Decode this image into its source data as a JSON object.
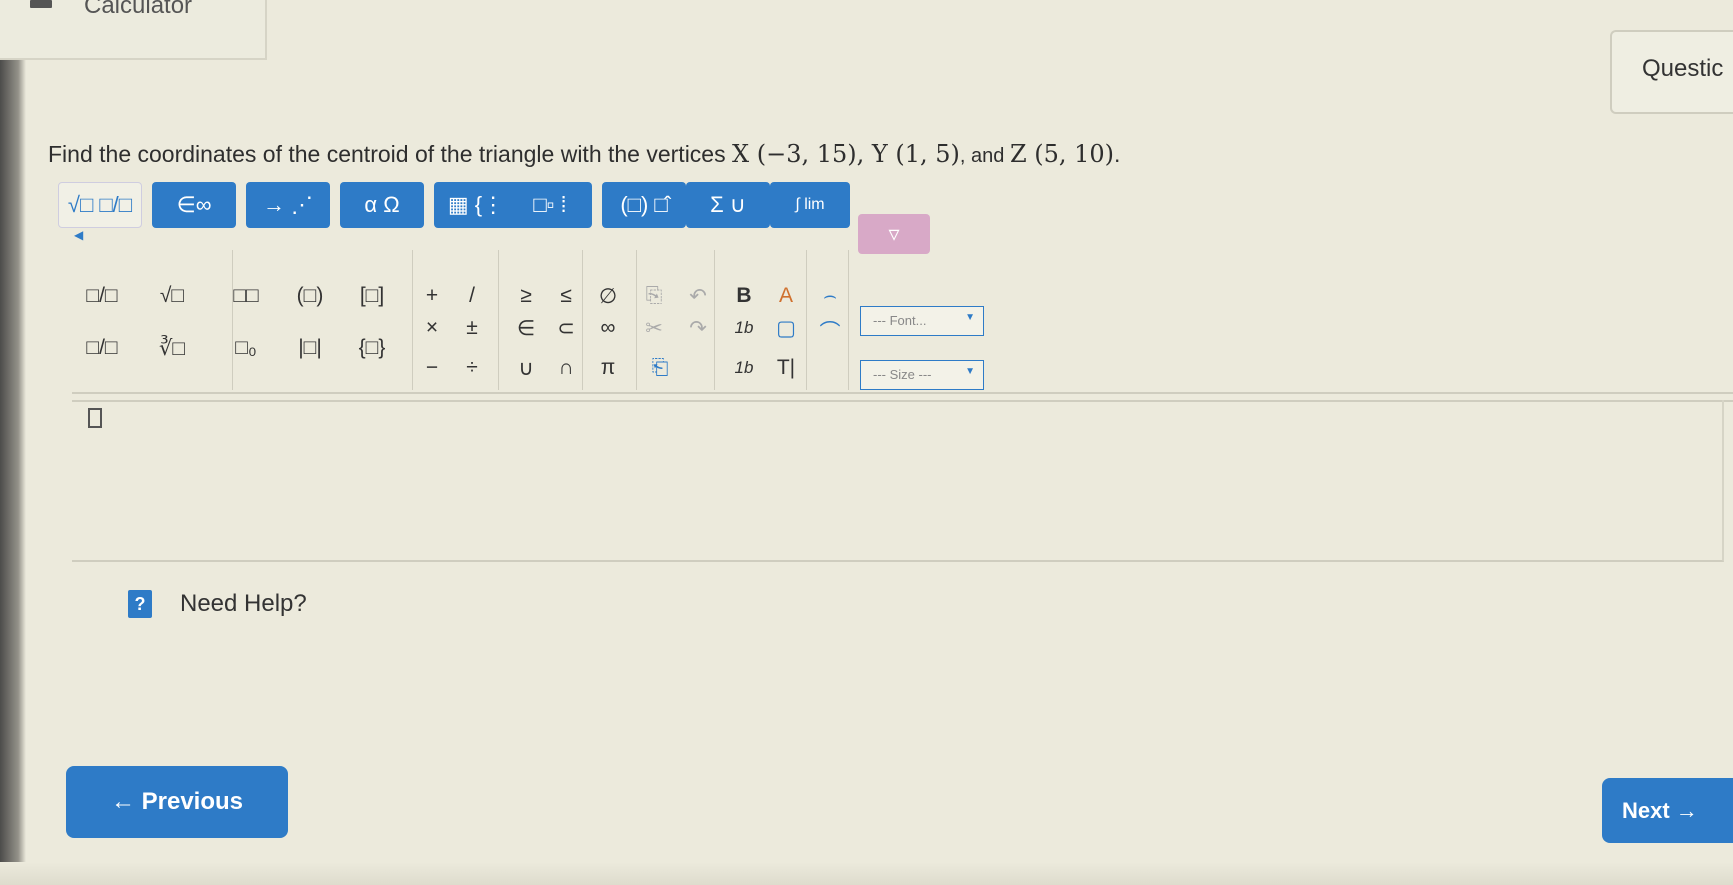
{
  "header": {
    "calculator_label": "Calculator",
    "question_label": "Questic"
  },
  "prompt": {
    "text_before": "Find the coordinates of the centroid of the triangle with the vertices ",
    "x_vertex": "X (−3, 15)",
    "comma1": ", ",
    "y_vertex": "Y (1, 5)",
    "and_text": ", and ",
    "z_vertex": "Z (5, 10)",
    "end": "."
  },
  "toolbar": {
    "tabs": [
      {
        "label": "√□ □/□",
        "active": true
      },
      {
        "label": "∈∞"
      },
      {
        "label": "→ ⋰"
      },
      {
        "label": "α Ω"
      },
      {
        "label": "▦ {⋮"
      },
      {
        "label": "□▫ ⁞"
      },
      {
        "label": "(□) □̂"
      },
      {
        "label": "Σ ∪"
      },
      {
        "label": "∫ lim"
      },
      {
        "label": "▿"
      }
    ]
  },
  "palette": {
    "row1": [
      "□/□",
      "√□",
      "□□",
      "(□)",
      "[□]",
      "+",
      "/",
      "≥",
      "≤",
      "∅",
      "⎘",
      "↶",
      "B",
      "A",
      "⌢"
    ],
    "row2": [
      "□/□",
      "∛□",
      "□₀",
      "|□|",
      "{□}",
      "×",
      "±",
      "∈",
      "⊂",
      "∞",
      "✂",
      "↷",
      "1b",
      "▢",
      "⌒"
    ],
    "row3": [
      "−",
      "÷",
      "∪",
      "∩",
      "π",
      "⎗",
      "1b",
      "T|"
    ],
    "font_dropdown": "--- Font...",
    "size_dropdown": "--- Size ---"
  },
  "help": {
    "icon": "?",
    "label": "Need Help?"
  },
  "nav": {
    "previous": "← Previous",
    "next": "Next →"
  },
  "colors": {
    "accent": "#2e7bc7",
    "background": "#eceadc"
  }
}
